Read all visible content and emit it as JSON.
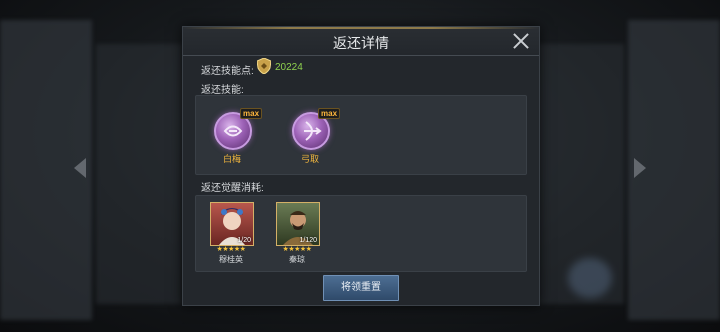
{
  "dialog": {
    "title": "返还详情",
    "points_label": "返还技能点:",
    "points_value": "20224",
    "skills_label": "返还技能:",
    "skills": [
      {
        "name": "白梅",
        "badge": "max"
      },
      {
        "name": "弓取",
        "badge": "max"
      }
    ],
    "cost_label": "返还觉醒消耗:",
    "heroes": [
      {
        "name": "穆桂英",
        "level": "1/20",
        "stars": "★★★★★"
      },
      {
        "name": "秦琼",
        "level": "1/120",
        "stars": "★★★★★"
      }
    ],
    "confirm_label": "将领重置"
  },
  "colors": {
    "accent_green": "#8fd14f",
    "skill_name": "#f0b53e",
    "button": "#3d5b7e"
  }
}
